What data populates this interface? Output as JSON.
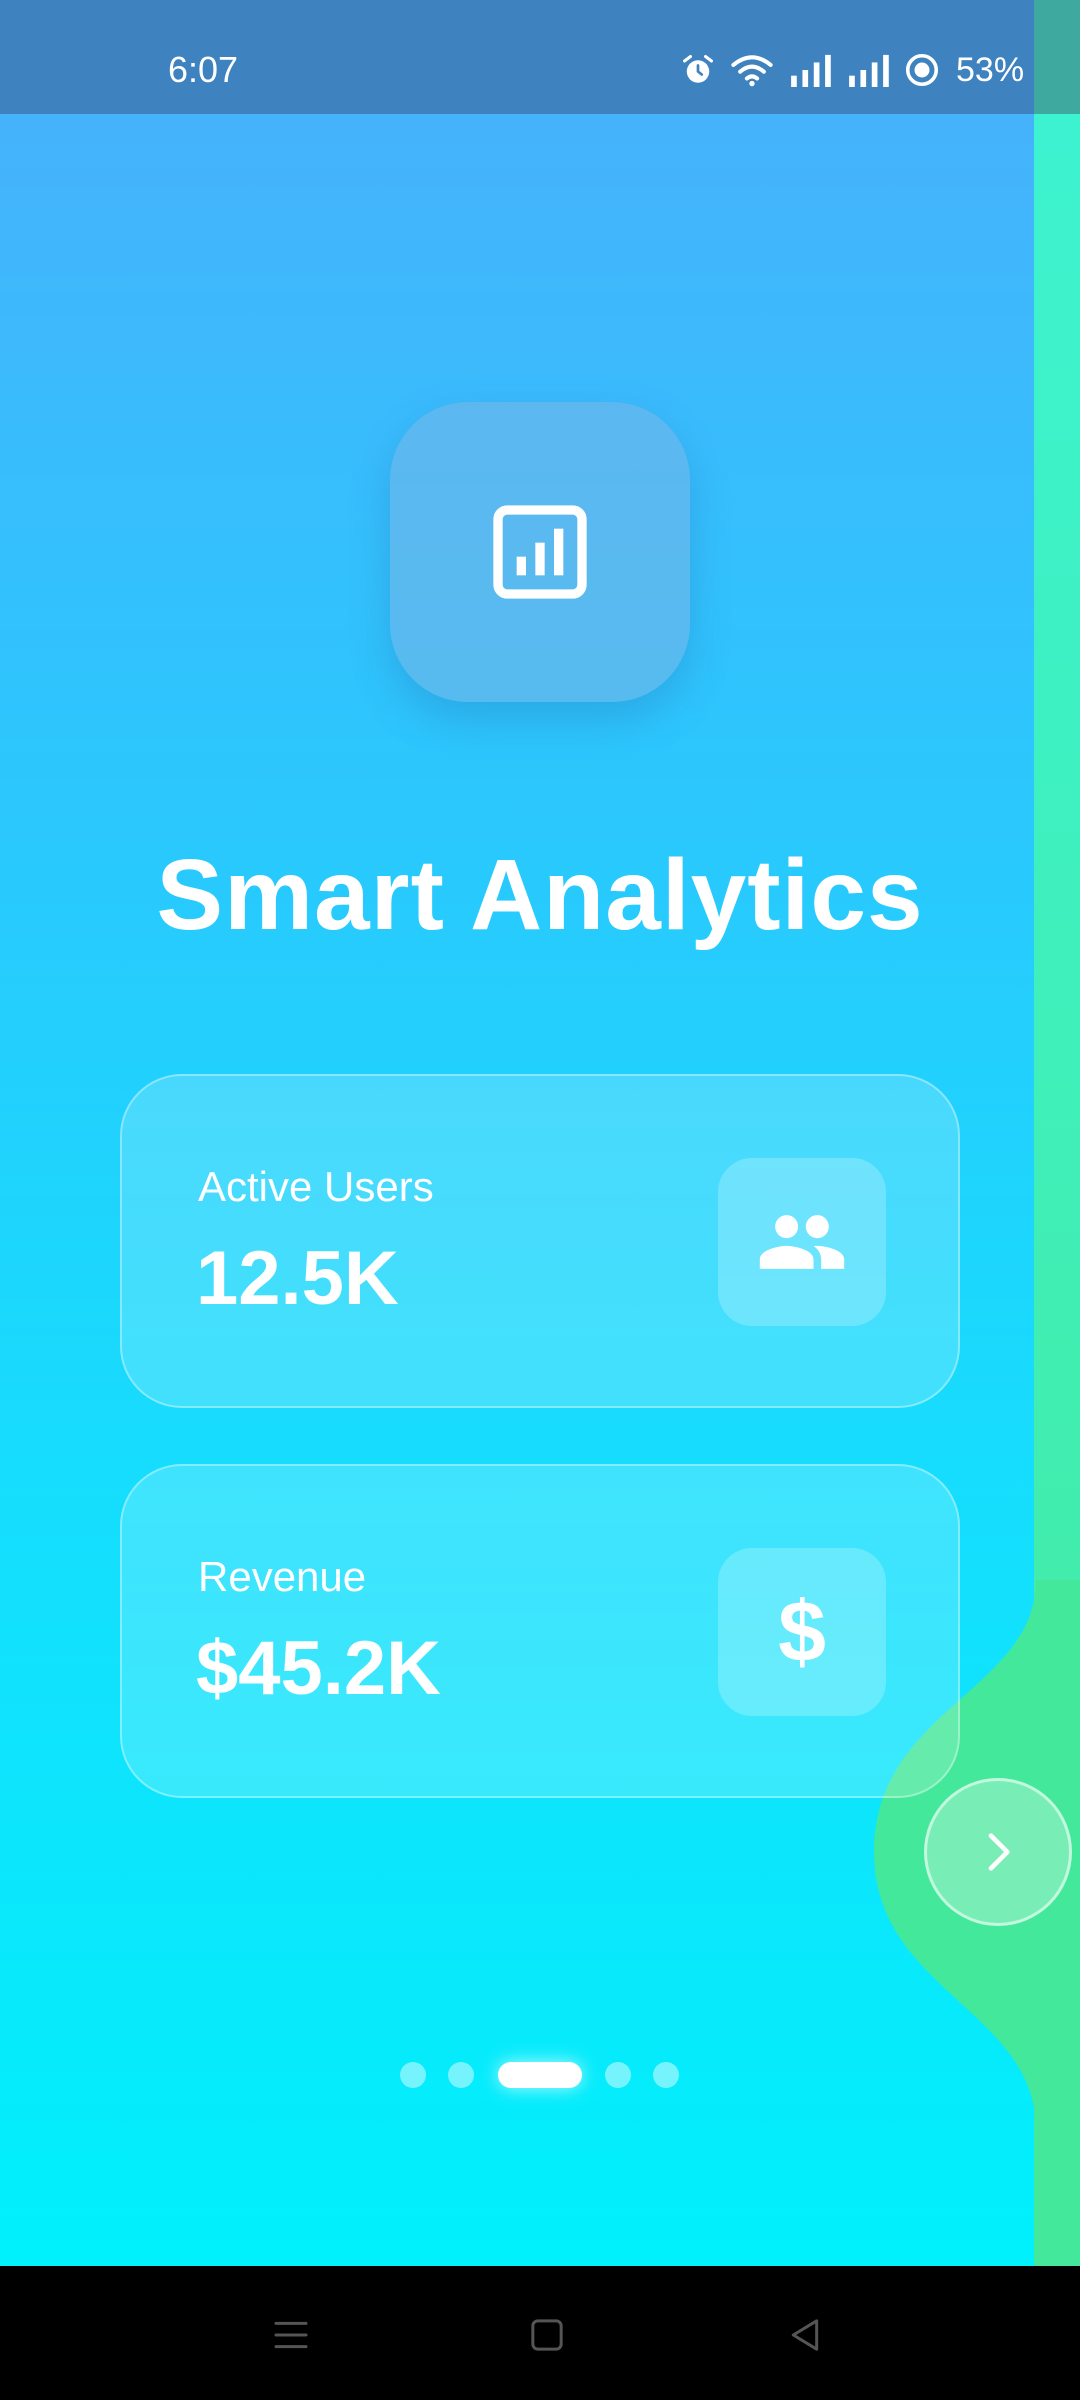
{
  "status_bar": {
    "time": "6:07",
    "battery_percent": "53%",
    "icons": [
      "alarm-icon",
      "wifi-icon",
      "signal-icon",
      "signal-icon",
      "battery-icon"
    ]
  },
  "hero": {
    "icon": "analytics-icon",
    "title": "Smart Analytics"
  },
  "cards": [
    {
      "label": "Active Users",
      "value": "12.5K",
      "icon": "group-icon"
    },
    {
      "label": "Revenue",
      "value": "$45.2K",
      "icon": "$"
    }
  ],
  "pager": {
    "total": 5,
    "active_index": 2
  },
  "next_button": {
    "icon": "chevron-right-icon"
  },
  "nav_bar": {
    "icons": [
      "menu-icon",
      "home-icon",
      "back-icon"
    ]
  },
  "colors": {
    "gradient_top": "#4aaffc",
    "gradient_bottom": "#00f0fc",
    "accent_green": "#44e89a",
    "status_bar": "#3e82bf"
  }
}
